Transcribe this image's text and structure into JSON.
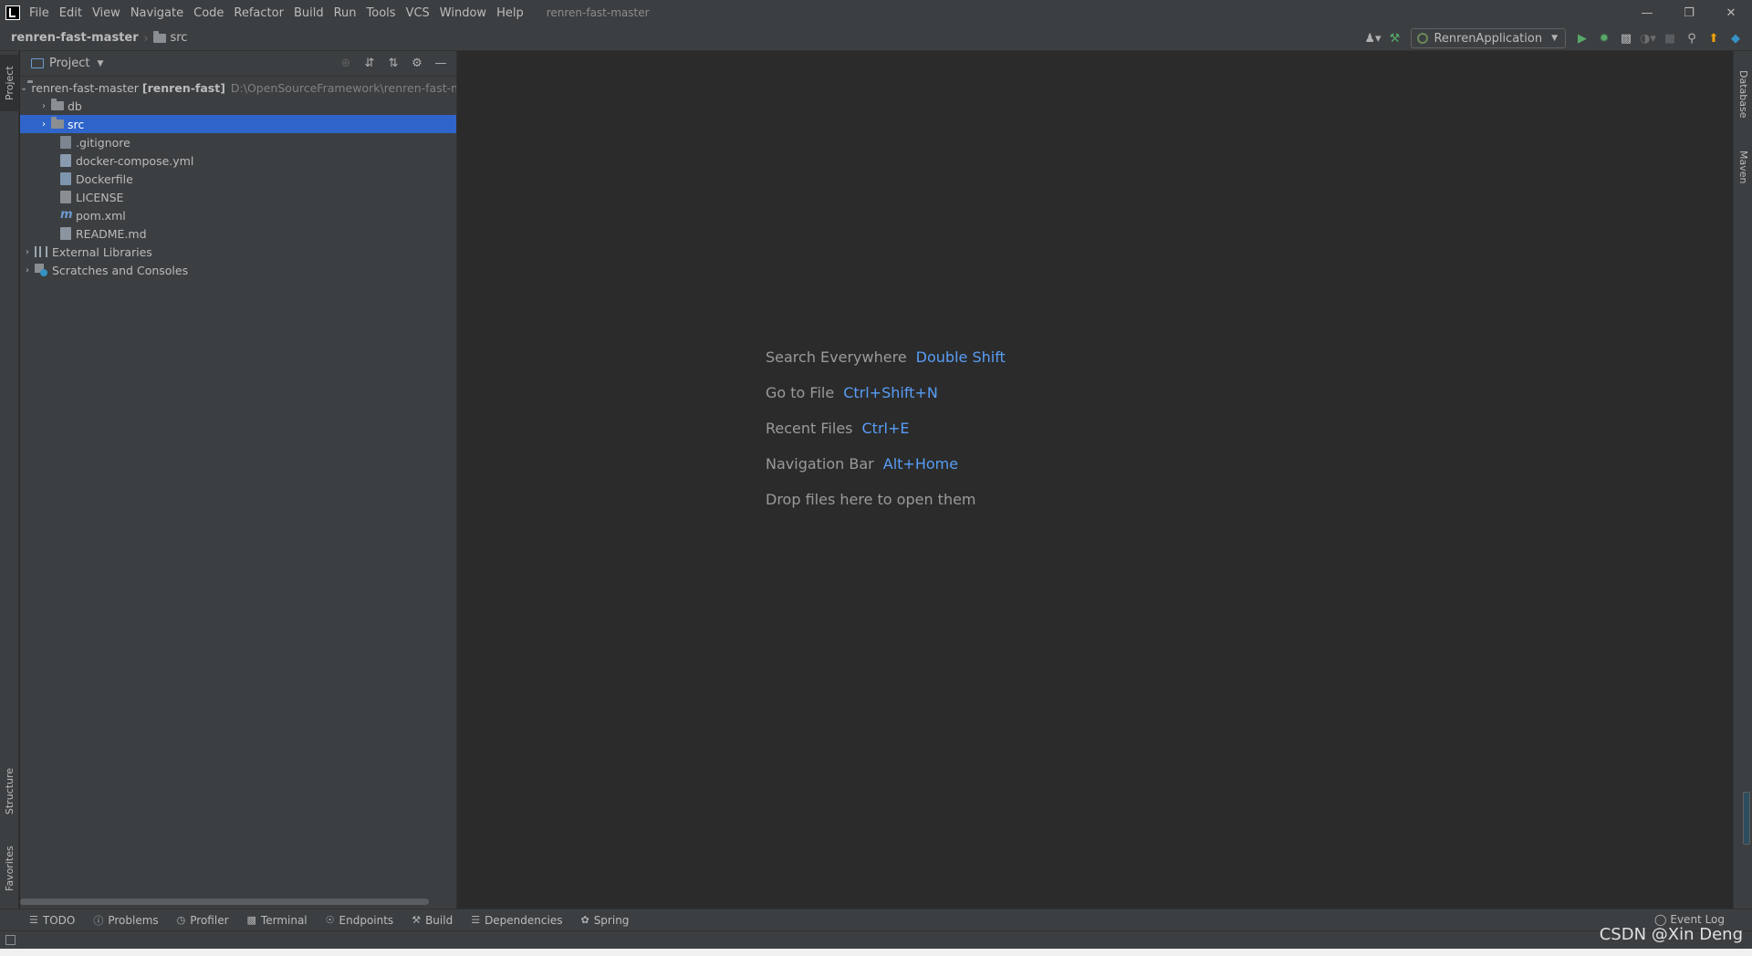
{
  "menubar": {
    "items": [
      "File",
      "Edit",
      "View",
      "Navigate",
      "Code",
      "Refactor",
      "Build",
      "Run",
      "Tools",
      "VCS",
      "Window",
      "Help"
    ],
    "window_title": "renren-fast-master"
  },
  "navbar": {
    "root": "renren-fast-master",
    "current": "src",
    "run_config": "RenrenApplication"
  },
  "left_strip": {
    "project": "Project",
    "structure": "Structure",
    "favorites": "Favorites"
  },
  "project_panel": {
    "title": "Project",
    "tree": {
      "root_name": "renren-fast-master",
      "root_module": "[renren-fast]",
      "root_path": "D:\\OpenSourceFramework\\renren-fast-m",
      "db": "db",
      "src": "src",
      "gitignore": ".gitignore",
      "docker_compose": "docker-compose.yml",
      "dockerfile": "Dockerfile",
      "license": "LICENSE",
      "pom": "pom.xml",
      "readme": "README.md",
      "external_libraries": "External Libraries",
      "scratches": "Scratches and Consoles"
    }
  },
  "welcome": {
    "search_label": "Search Everywhere",
    "search_key": "Double Shift",
    "goto_label": "Go to File",
    "goto_key": "Ctrl+Shift+N",
    "recent_label": "Recent Files",
    "recent_key": "Ctrl+E",
    "nav_label": "Navigation Bar",
    "nav_key": "Alt+Home",
    "drop_label": "Drop files here to open them"
  },
  "right_strip": {
    "database": "Database",
    "maven": "Maven"
  },
  "bottom_bar": {
    "todo": "TODO",
    "problems": "Problems",
    "profiler": "Profiler",
    "terminal": "Terminal",
    "endpoints": "Endpoints",
    "build": "Build",
    "dependencies": "Dependencies",
    "spring": "Spring",
    "event_log": "Event Log"
  },
  "watermark": "CSDN @Xin Deng"
}
